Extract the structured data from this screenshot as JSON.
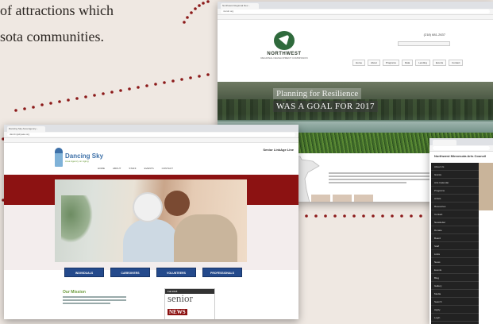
{
  "caption": {
    "line1": "of attractions which",
    "line2": "sota communities."
  },
  "northwest": {
    "tab": "Northwest Regional Dev...",
    "url": "nwrdc.org",
    "phone": "(218) 681-2637",
    "logo_name": "NORTHWEST",
    "logo_sub": "REGIONAL DEVELOPMENT COMMISSION",
    "nav": [
      "Home",
      "About",
      "Programs",
      "Data",
      "Lending",
      "Events",
      "Contact"
    ],
    "hero_line1": "Planning for Resilience",
    "hero_line2": "WAS A GOAL FOR 2017"
  },
  "dancing_sky": {
    "tab": "Dancing Sky Area Agency...",
    "url": "dancingskyaaa.org",
    "logo_line1": "Dancing Sky",
    "logo_line2": "Area Agency on Aging",
    "header_right": "Senior LinkAge Line",
    "nav": [
      "HOME",
      "ABOUT",
      "STAFF",
      "EVENTS",
      "CONTACT"
    ],
    "buttons": [
      "INDIVIDUALS",
      "CAREGIVERS",
      "VOLUNTEERS",
      "PROFESSIONALS"
    ],
    "mission_heading": "Our Mission",
    "senior_news_top": "Fall 2018",
    "senior_news_word1": "senior",
    "senior_news_word2": "NEWS"
  },
  "right_site": {
    "title": "Northwest Minnesota Arts Council",
    "side_items": [
      "About Us",
      "Grants",
      "Arts Calendar",
      "Programs",
      "Artists",
      "Resources",
      "Contact",
      "Newsletter",
      "Donate",
      "Board",
      "Staff",
      "Links",
      "News",
      "Events",
      "Blog",
      "Gallery",
      "Media",
      "Search",
      "Apply",
      "Login"
    ]
  },
  "colors": {
    "background": "#efe8e2",
    "dots": "#8c1a1a",
    "dancing_sky_red": "#8c1212",
    "dancing_sky_blue": "#244a8c",
    "northwest_green": "#2f6a3c"
  }
}
